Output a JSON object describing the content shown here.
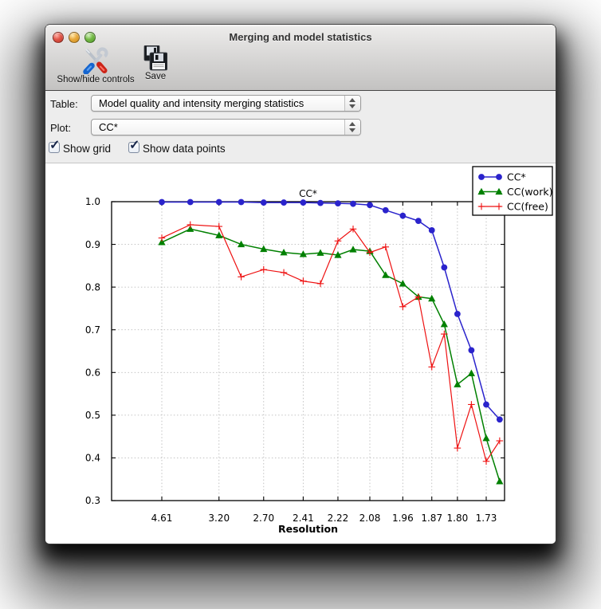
{
  "window": {
    "title": "Merging and model statistics"
  },
  "toolbar": {
    "buttons": [
      {
        "label": "Show/hide controls",
        "icon": "tools-icon"
      },
      {
        "label": "Save",
        "icon": "floppy-icon"
      }
    ]
  },
  "controls": {
    "table": {
      "label": "Table:",
      "value": "Model quality and intensity merging statistics"
    },
    "plot": {
      "label": "Plot:",
      "value": "CC*"
    },
    "checkboxes": [
      {
        "label": "Show grid",
        "checked": true
      },
      {
        "label": "Show data points",
        "checked": true
      }
    ]
  },
  "icons": {
    "check": "✓"
  },
  "chart_data": {
    "type": "line",
    "title": "CC*",
    "xlabel": "Resolution",
    "ylabel": "",
    "ylim": [
      0.3,
      1.0
    ],
    "y_ticks": [
      0.3,
      0.4,
      0.5,
      0.6,
      0.7,
      0.8,
      0.9,
      1.0
    ],
    "x_tick_labels": [
      "4.61",
      "3.20",
      "2.70",
      "2.41",
      "2.22",
      "2.08",
      "1.96",
      "1.87",
      "1.80",
      "1.73"
    ],
    "x_scale": "1/d^2",
    "grid": true,
    "legend_position": "upper right",
    "x_bins_d": [
      4.61,
      3.72,
      3.2,
      2.92,
      2.7,
      2.54,
      2.41,
      2.31,
      2.22,
      2.15,
      2.08,
      2.02,
      1.96,
      1.91,
      1.87,
      1.835,
      1.8,
      1.765,
      1.73,
      1.7
    ],
    "series": [
      {
        "name": "CC*",
        "color": "#2a23cc",
        "marker": "circle",
        "values": [
          0.999,
          0.999,
          0.999,
          0.999,
          0.998,
          0.998,
          0.998,
          0.997,
          0.996,
          0.995,
          0.992,
          0.98,
          0.967,
          0.955,
          0.933,
          0.846,
          0.737,
          0.652,
          0.525,
          0.49
        ]
      },
      {
        "name": "CC(work)",
        "color": "#008000",
        "marker": "triangle",
        "values": [
          0.905,
          0.936,
          0.921,
          0.9,
          0.889,
          0.881,
          0.877,
          0.88,
          0.875,
          0.888,
          0.884,
          0.828,
          0.808,
          0.777,
          0.773,
          0.713,
          0.572,
          0.598,
          0.446,
          0.345
        ]
      },
      {
        "name": "CC(free)",
        "color": "#ee1111",
        "marker": "plus",
        "values": [
          0.915,
          0.946,
          0.942,
          0.824,
          0.841,
          0.834,
          0.814,
          0.808,
          0.908,
          0.936,
          0.881,
          0.894,
          0.754,
          0.777,
          0.613,
          0.69,
          0.423,
          0.525,
          0.392,
          0.44
        ]
      }
    ]
  }
}
